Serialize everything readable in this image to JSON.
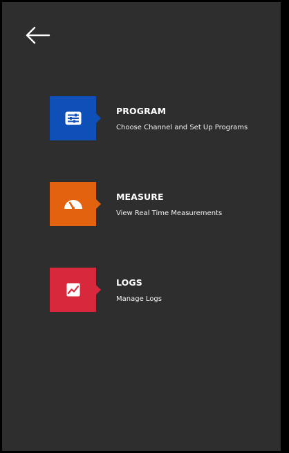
{
  "nav": {
    "back_icon": "arrow-left-icon"
  },
  "menu": [
    {
      "title": "PROGRAM",
      "description": "Choose Channel and Set Up Programs",
      "icon": "list-settings-icon",
      "color": "#0f4fb8"
    },
    {
      "title": "MEASURE",
      "description": "View Real Time Measurements",
      "icon": "gauge-icon",
      "color": "#e3620f"
    },
    {
      "title": "LOGS",
      "description": "Manage Logs",
      "icon": "trend-chart-icon",
      "color": "#d8283c"
    }
  ]
}
